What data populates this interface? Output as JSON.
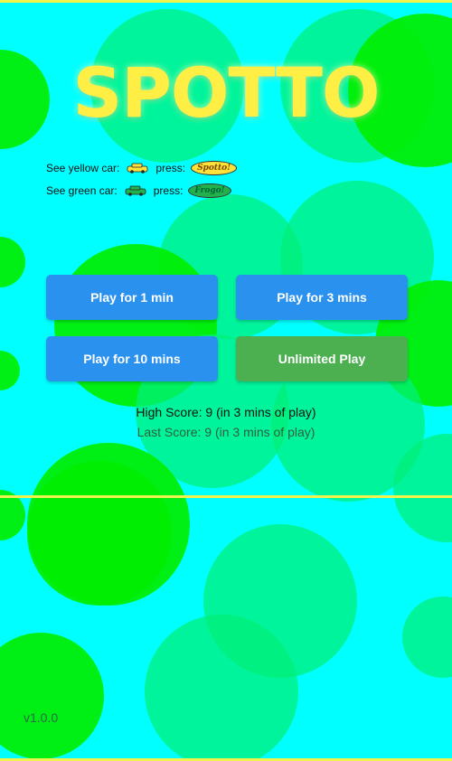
{
  "app": {
    "title": "SPOTTO",
    "version": "v1.0.0"
  },
  "instructions": [
    {
      "label": "See yellow car:",
      "press_label": "press:",
      "car_icon": "yellow-car-icon",
      "badge_text": "Spotto!",
      "badge_icon": "spotto-badge"
    },
    {
      "label": "See green car:",
      "press_label": "press:",
      "car_icon": "green-car-icon",
      "badge_text": "Frogo!",
      "badge_icon": "frogo-badge"
    }
  ],
  "buttons": {
    "play_1": "Play for 1 min",
    "play_3": "Play for 3 mins",
    "play_10": "Play for 10 mins",
    "unlimited": "Unlimited Play"
  },
  "scores": {
    "high": "High Score: 9 (in 3 mins of play)",
    "last": "Last Score: 9 (in 3 mins of play)"
  },
  "colors": {
    "background": "#00ffff",
    "circle_green": "#00ee00",
    "circle_mint": "#00f07a",
    "title_yellow": "#ffee44",
    "line_yellow": "#f2f24e",
    "button_blue": "#2a92ee",
    "button_green": "#4caf50",
    "car_yellow": "#ffe23a",
    "car_green": "#22b14c"
  }
}
